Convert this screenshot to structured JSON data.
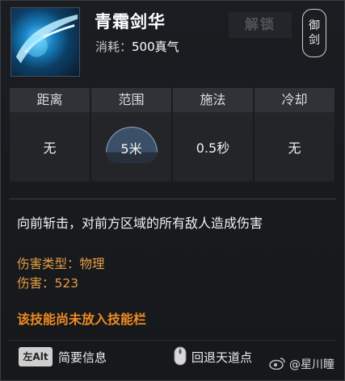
{
  "skill": {
    "name": "青霜剑华",
    "cost_label": "消耗：",
    "cost_value": "500真气",
    "unlock_label": "解锁",
    "school_badge": [
      "御",
      "剑"
    ]
  },
  "stats": {
    "headers": [
      "距离",
      "范围",
      "施法",
      "冷却"
    ],
    "values": [
      "无",
      "5米",
      "0.5秒",
      "无"
    ]
  },
  "description": "向前斩击，对前方区域的所有敌人造成伤害",
  "damage_type": "伤害类型：物理",
  "damage": "伤害：523",
  "warning": "该技能尚未放入技能栏",
  "footer": {
    "alt_key": "左Alt",
    "brief_info": "简要信息",
    "return_label": "回退天道点",
    "watermark": "@星川瞳"
  },
  "colors": {
    "accent_orange": "#ef8a22",
    "damage_text": "#e59d43",
    "panel_bg": "#1a1d21"
  },
  "icons": [
    "sword-skill-icon",
    "mouse-icon",
    "weibo-icon"
  ]
}
